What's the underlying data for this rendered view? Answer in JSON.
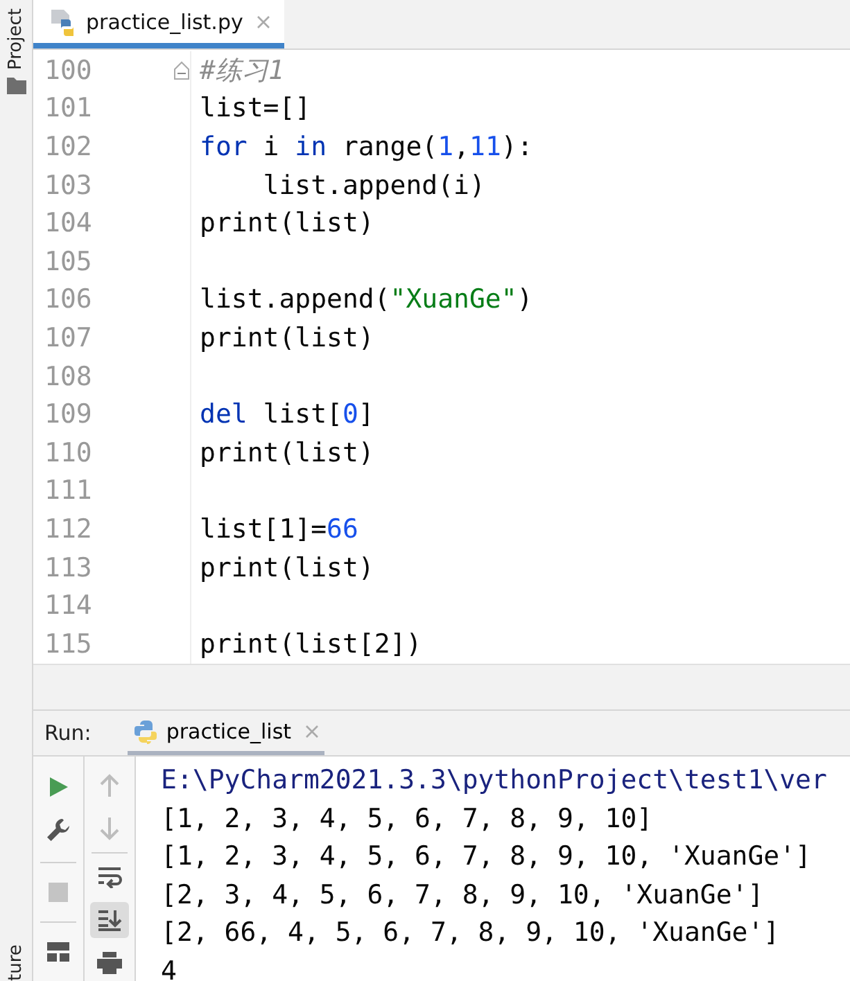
{
  "side_strip": {
    "top_label": "Project",
    "bottom_label": "ture"
  },
  "editor_tab": {
    "title": "practice_list.py",
    "selected": true
  },
  "code_lines": [
    {
      "number": "100",
      "tokens": [
        {
          "kind": "comment",
          "text": "#练习1"
        }
      ]
    },
    {
      "number": "101",
      "tokens": [
        {
          "kind": "plain",
          "text": "list=[]"
        }
      ]
    },
    {
      "number": "102",
      "tokens": [
        {
          "kind": "keyword",
          "text": "for"
        },
        {
          "kind": "plain",
          "text": " i "
        },
        {
          "kind": "keyword",
          "text": "in"
        },
        {
          "kind": "plain",
          "text": " range("
        },
        {
          "kind": "number",
          "text": "1"
        },
        {
          "kind": "plain",
          "text": ","
        },
        {
          "kind": "number",
          "text": "11"
        },
        {
          "kind": "plain",
          "text": "):"
        }
      ]
    },
    {
      "number": "103",
      "tokens": [
        {
          "kind": "plain",
          "text": "    list.append(i)"
        }
      ]
    },
    {
      "number": "104",
      "tokens": [
        {
          "kind": "plain",
          "text": "print(list)"
        }
      ]
    },
    {
      "number": "105"
    },
    {
      "number": "106",
      "tokens": [
        {
          "kind": "plain",
          "text": "list.append("
        },
        {
          "kind": "string",
          "text": "\"XuanGe\""
        },
        {
          "kind": "plain",
          "text": ")"
        }
      ]
    },
    {
      "number": "107",
      "tokens": [
        {
          "kind": "plain",
          "text": "print(list)"
        }
      ]
    },
    {
      "number": "108"
    },
    {
      "number": "109",
      "tokens": [
        {
          "kind": "keyword",
          "text": "del"
        },
        {
          "kind": "plain",
          "text": " list["
        },
        {
          "kind": "number",
          "text": "0"
        },
        {
          "kind": "plain",
          "text": "]"
        }
      ]
    },
    {
      "number": "110",
      "tokens": [
        {
          "kind": "plain",
          "text": "print(list)"
        }
      ]
    },
    {
      "number": "111"
    },
    {
      "number": "112",
      "tokens": [
        {
          "kind": "plain",
          "text": "list[1]="
        },
        {
          "kind": "number",
          "text": "66"
        }
      ]
    },
    {
      "number": "113",
      "tokens": [
        {
          "kind": "plain",
          "text": "print(list)"
        }
      ]
    },
    {
      "number": "114"
    },
    {
      "number": "115",
      "tokens": [
        {
          "kind": "plain",
          "text": "print(list[2])"
        }
      ]
    }
  ],
  "run_panel": {
    "label": "Run:",
    "tab": {
      "title": "practice_list",
      "selected": true
    },
    "left_tools": [
      {
        "kind": "run"
      },
      {
        "kind": "wrench"
      },
      {
        "kind": "stop"
      },
      {
        "kind": "layout"
      }
    ],
    "right_tools": [
      {
        "kind": "up",
        "disabled": true,
        "selected": false
      },
      {
        "kind": "down",
        "disabled": true,
        "selected": false
      },
      {
        "kind": "wrap",
        "disabled": false,
        "selected": false
      },
      {
        "kind": "scroll-end",
        "disabled": false,
        "selected": true
      },
      {
        "kind": "print",
        "disabled": false,
        "selected": false
      }
    ],
    "console": [
      {
        "kind": "command",
        "text": "E:\\PyCharm2021.3.3\\pythonProject\\test1\\ver"
      },
      {
        "kind": "output",
        "text": "[1, 2, 3, 4, 5, 6, 7, 8, 9, 10]"
      },
      {
        "kind": "output",
        "text": "[1, 2, 3, 4, 5, 6, 7, 8, 9, 10, 'XuanGe']"
      },
      {
        "kind": "output",
        "text": "[2, 3, 4, 5, 6, 7, 8, 9, 10, 'XuanGe']"
      },
      {
        "kind": "output",
        "text": "[2, 66, 4, 5, 6, 7, 8, 9, 10, 'XuanGe']"
      },
      {
        "kind": "output",
        "text": "4"
      }
    ]
  }
}
